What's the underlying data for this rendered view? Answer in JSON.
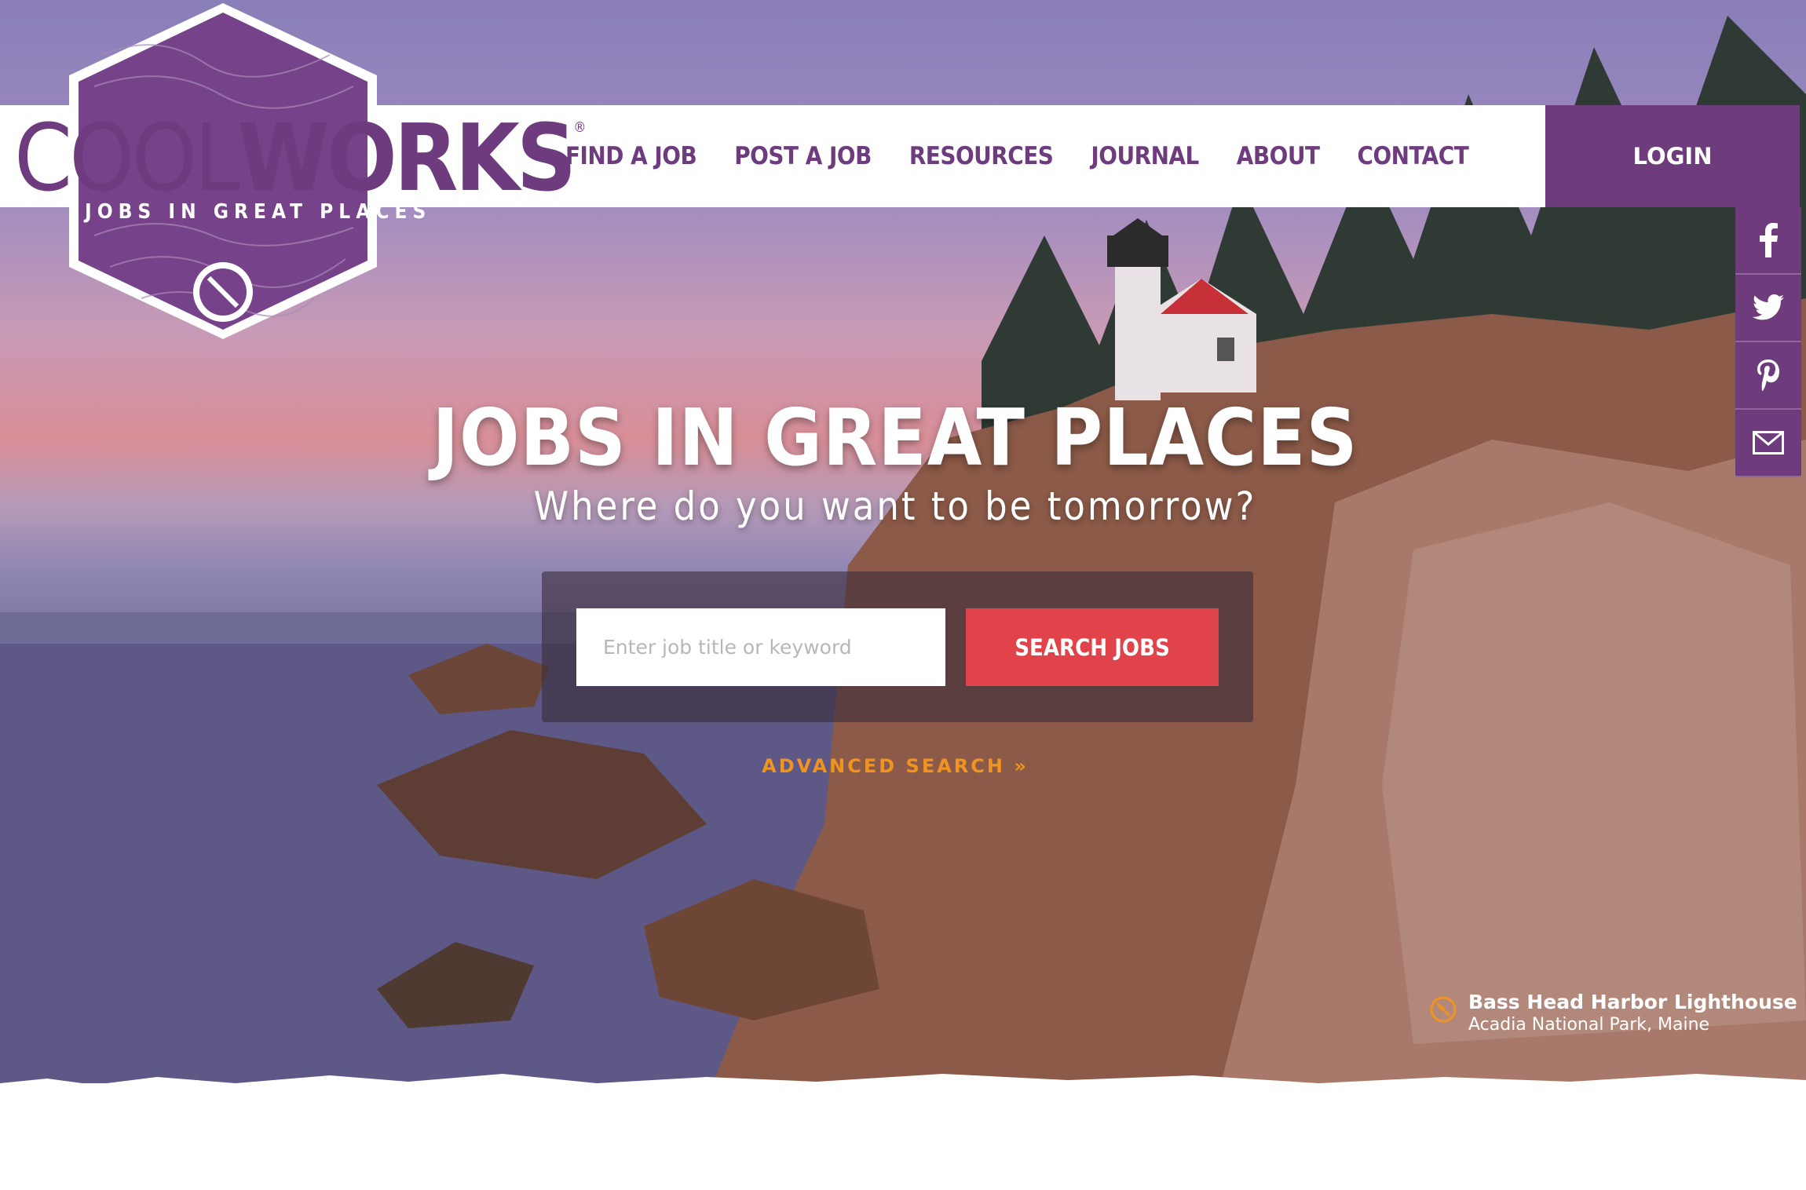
{
  "logo": {
    "word_light": "COOL",
    "word_bold": "WORKS",
    "registered": "®",
    "tagline": "JOBS IN GREAT PLACES"
  },
  "nav": {
    "items": [
      {
        "label": "FIND A JOB"
      },
      {
        "label": "POST A JOB"
      },
      {
        "label": "RESOURCES"
      },
      {
        "label": "JOURNAL"
      },
      {
        "label": "ABOUT"
      },
      {
        "label": "CONTACT"
      }
    ],
    "login_label": "LOGIN"
  },
  "social": {
    "icons": [
      "facebook-icon",
      "twitter-icon",
      "pinterest-icon",
      "email-icon"
    ]
  },
  "hero": {
    "title": "JOBS IN GREAT PLACES",
    "subtitle": "Where do you want to be tomorrow?",
    "search": {
      "placeholder": "Enter job title or keyword",
      "value": "",
      "button_label": "SEARCH JOBS"
    },
    "advanced_search": "ADVANCED SEARCH »",
    "credit": {
      "place": "Bass Head Harbor Lighthouse",
      "location": "Acadia National Park, Maine"
    }
  },
  "colors": {
    "brand_purple": "#6e3c7e",
    "search_red": "#e0444a",
    "accent_orange": "#f0941f"
  }
}
